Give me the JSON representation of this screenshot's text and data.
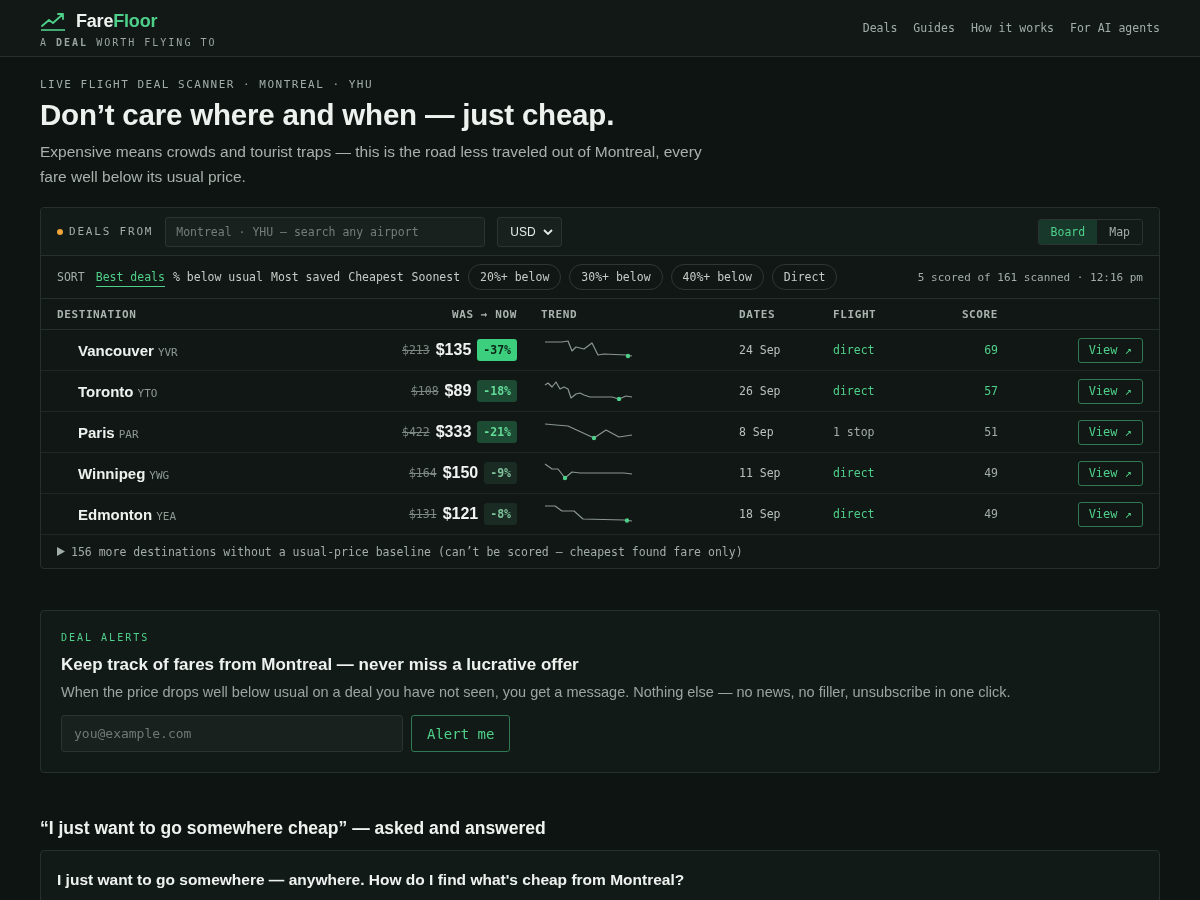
{
  "header": {
    "logo": {
      "first": "Fare",
      "second": "Floor"
    },
    "tagline": "A **DEAL** WORTH FLYING TO",
    "nav": [
      {
        "label": "Deals"
      },
      {
        "label": "Guides"
      },
      {
        "label": "How it works"
      },
      {
        "label": "For AI agents"
      }
    ]
  },
  "hero": {
    "eyebrow": "LIVE FLIGHT DEAL SCANNER · MONTREAL · YHU",
    "title": "Don’t care where and when — just cheap.",
    "subtitle": "Expensive means crowds and tourist traps — this is the road less traveled out of Montreal, every fare well below its usual price."
  },
  "deals_panel": {
    "origin_label": "DEALS FROM",
    "search": {
      "placeholder": "Montreal · YHU — search any airport"
    },
    "currency": "USD",
    "views": [
      {
        "label": "Board",
        "selected": true
      },
      {
        "label": "Map",
        "selected": false
      }
    ],
    "sort_label": "SORT",
    "sort_options": [
      {
        "label": "Best deals",
        "selected": true
      },
      {
        "label": "% below usual",
        "selected": false
      },
      {
        "label": "Most saved",
        "selected": false
      },
      {
        "label": "Cheapest",
        "selected": false
      },
      {
        "label": "Soonest",
        "selected": false
      }
    ],
    "filters": [
      {
        "label": "20%+ below",
        "selected": false
      },
      {
        "label": "30%+ below",
        "selected": false
      },
      {
        "label": "40%+ below",
        "selected": false
      },
      {
        "label": "Direct",
        "selected": false
      }
    ],
    "summary": "5 scored of 161 scanned · 12:16 pm",
    "columns": [
      "DESTINATION",
      "WAS → NOW",
      "TREND",
      "DATES",
      "FLIGHT",
      "SCORE"
    ],
    "rows": [
      {
        "kind": "strong",
        "city": "Vancouver",
        "code": "YVR",
        "was": "$213",
        "now": "$135",
        "discount": "-37%",
        "dates": "24 Sep",
        "flight": "direct",
        "direct": true,
        "score": "69",
        "highlight": true,
        "action": "View ↗"
      },
      {
        "kind": "good",
        "city": "Toronto",
        "code": "YTO",
        "was": "$108",
        "now": "$89",
        "discount": "-18%",
        "dates": "26 Sep",
        "flight": "direct",
        "direct": true,
        "score": "57",
        "highlight": true,
        "action": "View ↗"
      },
      {
        "kind": "good",
        "city": "Paris",
        "code": "PAR",
        "was": "$422",
        "now": "$333",
        "discount": "-21%",
        "dates": "8 Sep",
        "flight": "1 stop",
        "direct": false,
        "score": "51",
        "highlight": false,
        "action": "View ↗"
      },
      {
        "kind": "mild",
        "city": "Winnipeg",
        "code": "YWG",
        "was": "$164",
        "now": "$150",
        "discount": "-9%",
        "dates": "11 Sep",
        "flight": "direct",
        "direct": true,
        "score": "49",
        "highlight": false,
        "action": "View ↗"
      },
      {
        "kind": "mild",
        "city": "Edmonton",
        "code": "YEA",
        "was": "$131",
        "now": "$121",
        "discount": "-8%",
        "dates": "18 Sep",
        "flight": "direct",
        "direct": true,
        "score": "49",
        "highlight": false,
        "action": "View ↗"
      }
    ],
    "more": {
      "label": "156 more destinations without a usual-price baseline (can’t be scored — cheapest found fare only)",
      "expanded": false
    }
  },
  "alerts": {
    "eyebrow": "DEAL ALERTS",
    "title": "Keep track of fares from Montreal — never miss a lucrative offer",
    "text": "When the price drops well below usual on a deal you have not seen, you get a message. Nothing else — no news, no filler, unsubscribe in one click.",
    "email": {
      "placeholder": "you@example.com"
    },
    "button": "Alert me"
  },
  "faq": {
    "heading": "“I just want to go somewhere cheap” — asked and answered",
    "items": [
      {
        "question": "I just want to go somewhere — anywhere. How do I find what's cheap from Montreal?"
      }
    ]
  }
}
